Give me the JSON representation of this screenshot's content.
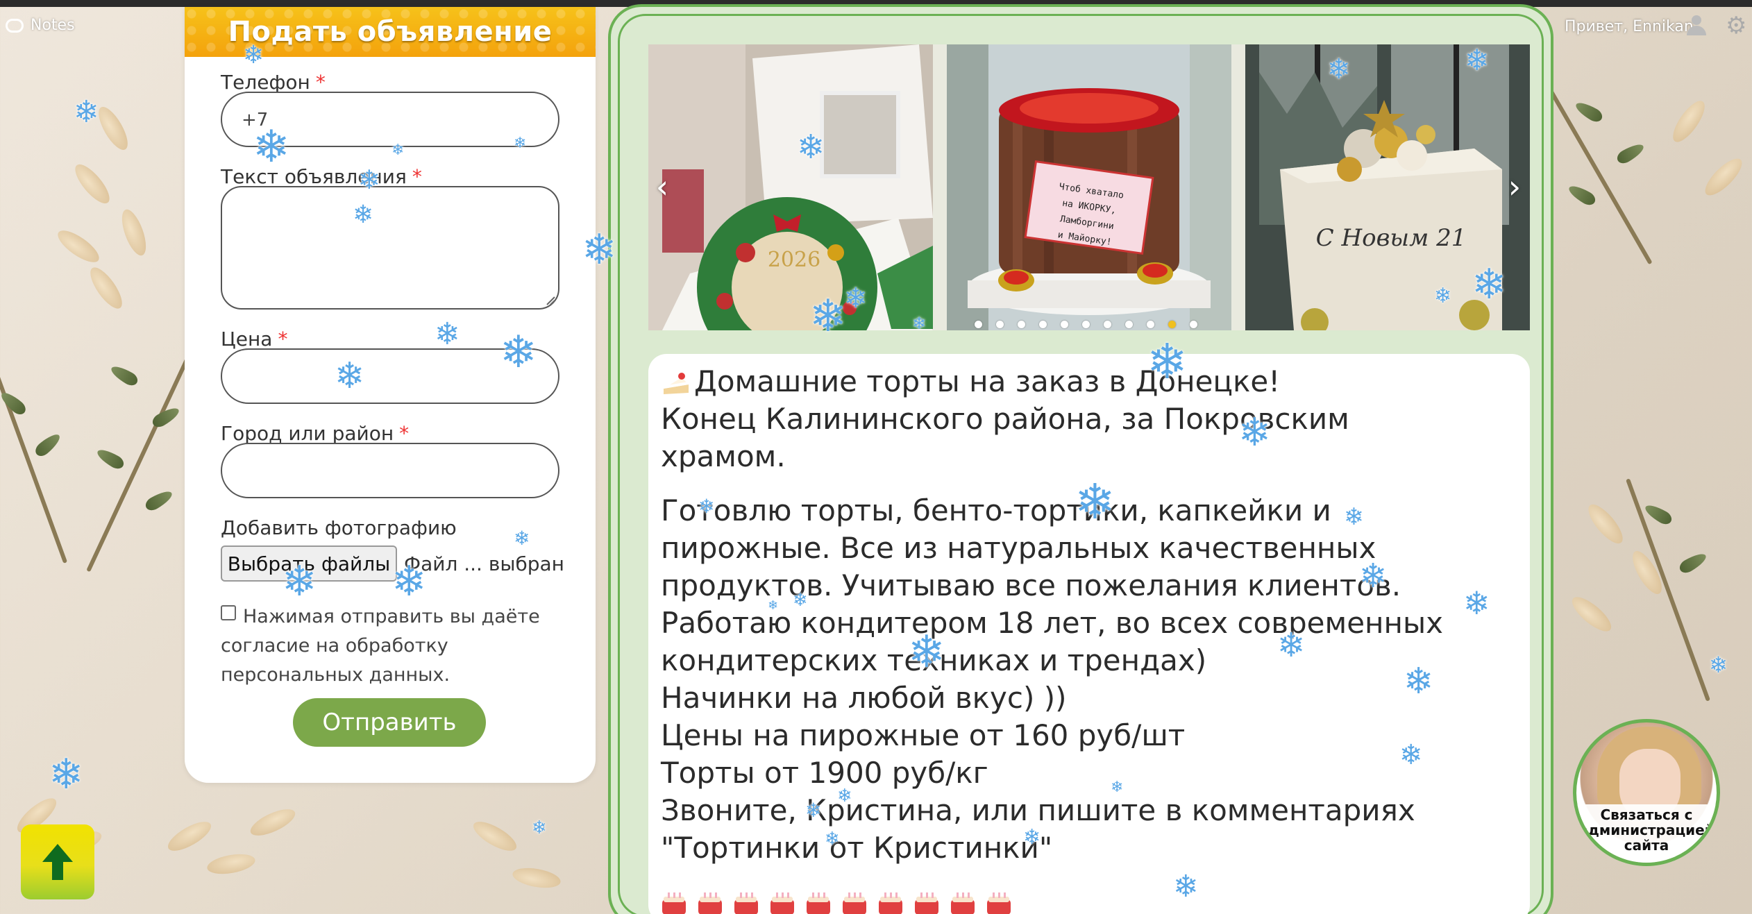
{
  "notes": {
    "label": "Notes"
  },
  "form": {
    "title": "Подать объявление",
    "phone_label": "Телефон",
    "phone_value": "+7",
    "text_label": "Текст объявления",
    "price_label": "Цена",
    "city_label": "Город или район",
    "photo_label": "Добавить фотографию",
    "file_button": "Выбрать файлы",
    "file_status": "Файл ... выбран",
    "required_mark": "*",
    "consent": "Нажимая отправить вы даёте согласие на обработку персональных данных.",
    "submit": "Отправить"
  },
  "header": {
    "greeting": "Привет, Ennikan"
  },
  "carousel": {
    "prev": "‹",
    "next": "›",
    "photos": [
      {
        "name": "wreath-cake-2026",
        "caption": "2026"
      },
      {
        "name": "caviar-barrel-cake",
        "caption": "Чтоб хватало на ИКОРКУ, Ламборгини и Майорку!"
      },
      {
        "name": "new-year-cube-cake",
        "caption": "С Новым 21"
      }
    ],
    "dots_total": 11,
    "active_dot": 9
  },
  "post": {
    "line1": "Домашние торты на заказ в Донецке!",
    "line2": "Конец Калининского района, за Покровским",
    "line3": "храмом.",
    "body": [
      "Готовлю торты, бенто-тортики, капкейки и",
      "пирожные. Все из натуральных качественных",
      "продуктов. Учитываю все пожелания клиентов.",
      "Работаю кондитером 18 лет, во всех современных",
      "кондитерских техниках и трендах)",
      "Начинки на любой вкус) ))",
      "Цены на пирожные от 160 руб/шт",
      "Торты от 1900 руб/кг",
      "Звоните, Кристина, или пишите в комментариях",
      "\"Тортинки от Кристинки\""
    ],
    "emoji_count": 10
  },
  "support": {
    "label": "Связаться с администрацией сайта"
  },
  "colors": {
    "accent_green": "#7ca84a",
    "frame_green": "#6bb154",
    "header_yellow": "#f4a20c",
    "snow_blue": "#5aa7e6"
  }
}
